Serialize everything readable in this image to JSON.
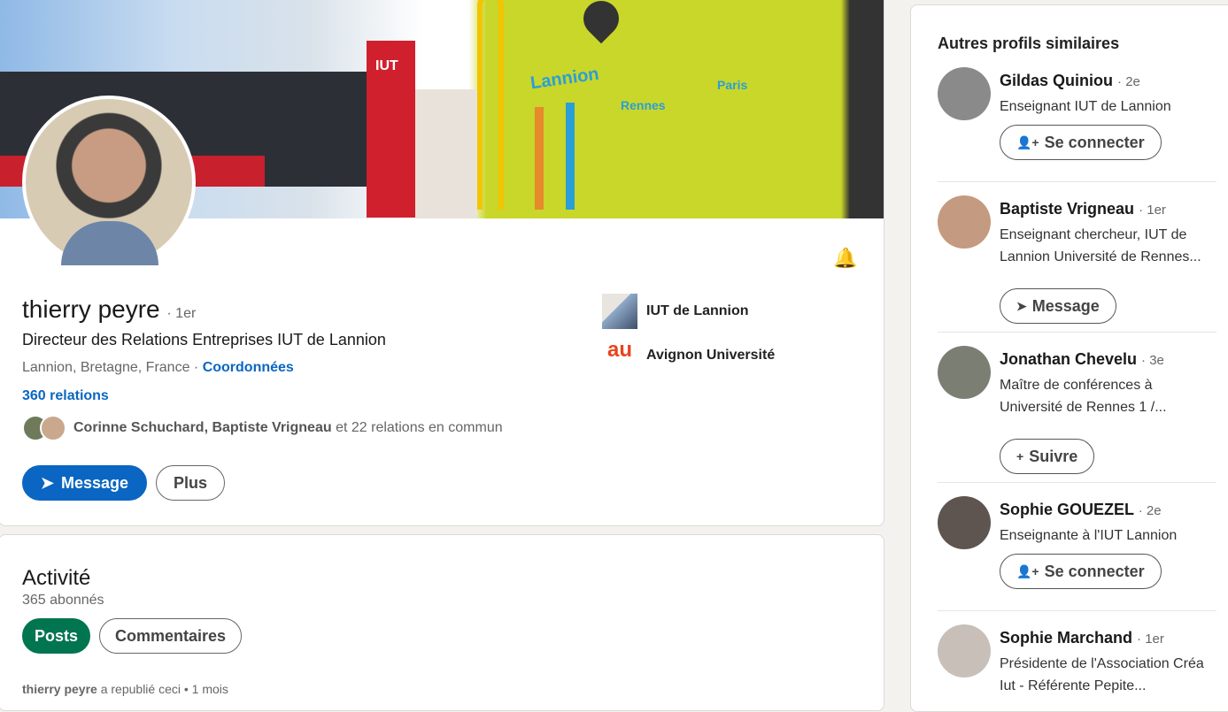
{
  "profile": {
    "name": "thierry peyre",
    "degree": "· 1er",
    "headline": "Directeur des Relations Entreprises IUT de Lannion",
    "location": "Lannion, Bretagne, France ·",
    "contact_link": "Coordonnées",
    "connections": "360 relations",
    "mutual_names": "Corinne Schuchard, Baptiste Vrigneau",
    "mutual_rest": "et 22 relations en commun",
    "message_label": "Message",
    "more_label": "Plus",
    "banner_labels": [
      "IUT",
      "Lannion",
      "Rennes",
      "Paris"
    ],
    "orgs": [
      {
        "name": "IUT de Lannion"
      },
      {
        "name": "Avignon Université"
      }
    ]
  },
  "activity": {
    "title": "Activité",
    "followers": "365 abonnés",
    "tabs": [
      {
        "label": "Posts",
        "active": true
      },
      {
        "label": "Commentaires",
        "active": false
      }
    ],
    "post_author": "thierry peyre",
    "post_meta": "a republié ceci • 1 mois"
  },
  "sidebar": {
    "title": "Autres profils similaires",
    "people": [
      {
        "name": "Gildas Quiniou",
        "degree": "· 2e",
        "desc": "Enseignant IUT de Lannion",
        "action": "Se connecter",
        "icon": "add-person-icon"
      },
      {
        "name": "Baptiste Vrigneau",
        "degree": "· 1er",
        "desc": "Enseignant chercheur, IUT de Lannion Université de Rennes...",
        "action": "Message",
        "icon": "send-icon"
      },
      {
        "name": "Jonathan Chevelu",
        "degree": "· 3e",
        "desc": "Maître de conférences à Université de Rennes 1 /...",
        "action": "Suivre",
        "icon": "plus-icon"
      },
      {
        "name": "Sophie GOUEZEL",
        "degree": "· 2e",
        "desc": "Enseignante à l'IUT Lannion",
        "action": "Se connecter",
        "icon": "add-person-icon"
      },
      {
        "name": "Sophie Marchand",
        "degree": "· 1er",
        "desc": "Présidente de l'Association Créa Iut - Référente Pepite...",
        "action": "",
        "icon": ""
      }
    ]
  },
  "colors": {
    "primary": "#0a66c2",
    "active_tab": "#01754f"
  }
}
